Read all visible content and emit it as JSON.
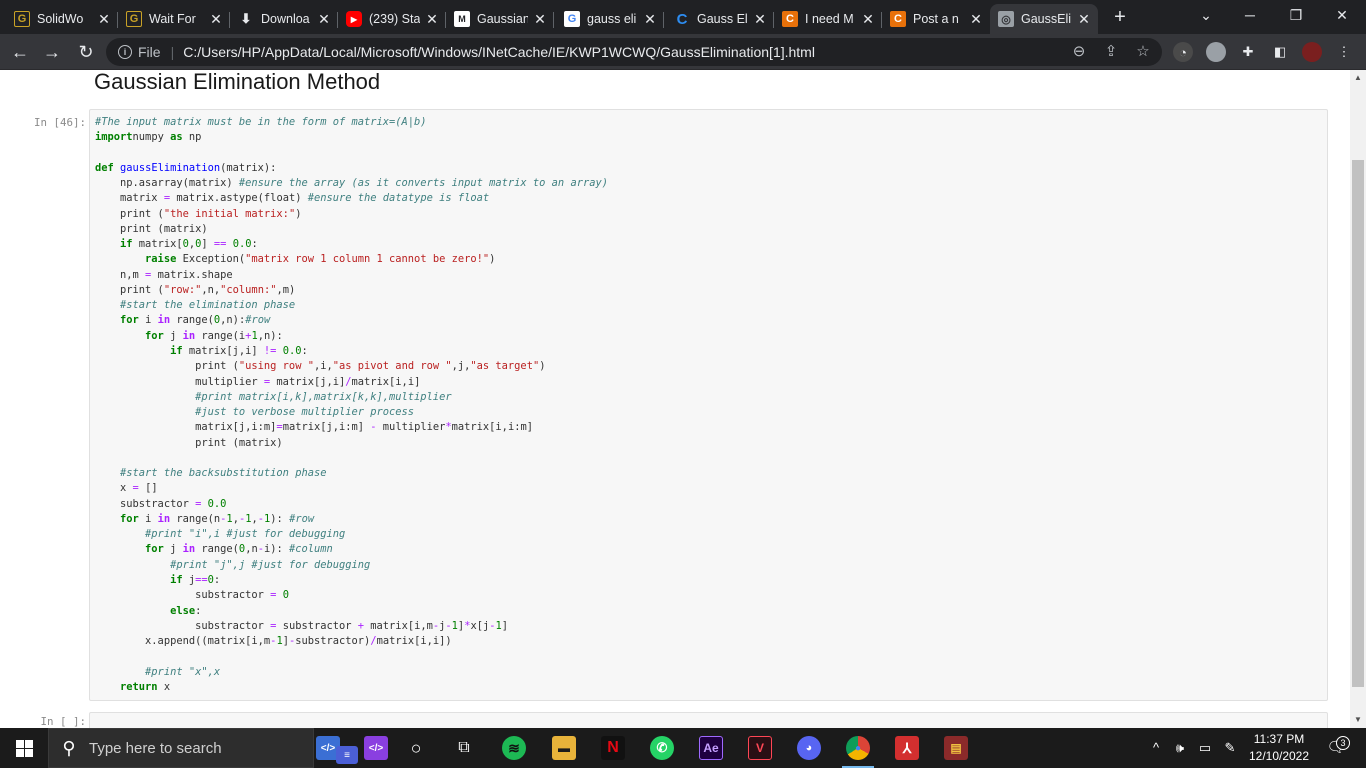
{
  "browser": {
    "tabs": [
      {
        "title": "SolidWo",
        "favicon": "g-icon"
      },
      {
        "title": "Wait For",
        "favicon": "g-icon"
      },
      {
        "title": "Downloa",
        "favicon": "download-icon"
      },
      {
        "title": "(239) Sta",
        "favicon": "youtube-icon"
      },
      {
        "title": "Gaussian",
        "favicon": "site-icon"
      },
      {
        "title": "gauss eli",
        "favicon": "google-icon"
      },
      {
        "title": "Gauss El",
        "favicon": "c-icon"
      },
      {
        "title": "I need M",
        "favicon": "chegg-icon"
      },
      {
        "title": "Post a n",
        "favicon": "chegg-icon"
      },
      {
        "title": "GaussEli",
        "favicon": "globe-icon",
        "active": true
      }
    ],
    "address": {
      "scheme_label": "File",
      "url": "C:/Users/HP/AppData/Local/Microsoft/Windows/INetCache/IE/KWP1WCWQ/GaussElimination[1].html"
    }
  },
  "notebook": {
    "heading": "Gaussian Elimination Method",
    "cell1_prompt": "In [46]:",
    "cell2_prompt": "In [ ]:",
    "code_lines": [
      [
        [
          "c-com",
          "#The input matrix must be in the form of matrix=(A|b)"
        ]
      ],
      [
        [
          "c-kw",
          "import"
        ],
        [
          "",
          "numpy "
        ],
        [
          "c-kw",
          "as"
        ],
        [
          "",
          " np"
        ]
      ],
      [
        [
          "",
          ""
        ]
      ],
      [
        [
          "c-kw",
          "def"
        ],
        [
          "",
          " "
        ],
        [
          "c-fn",
          "gaussElimination"
        ],
        [
          "",
          "(matrix):"
        ]
      ],
      [
        [
          "",
          "    np.asarray(matrix) "
        ],
        [
          "c-com",
          "#ensure the array (as it converts input matrix to an array)"
        ]
      ],
      [
        [
          "",
          "    matrix "
        ],
        [
          "c-op",
          "="
        ],
        [
          "",
          " matrix.astype(float) "
        ],
        [
          "c-com",
          "#ensure the datatype is float"
        ]
      ],
      [
        [
          "",
          "    print ("
        ],
        [
          "c-str",
          "\"the initial matrix:\""
        ],
        [
          "",
          ")"
        ]
      ],
      [
        [
          "",
          "    print (matrix)"
        ]
      ],
      [
        [
          "",
          "    "
        ],
        [
          "c-kw",
          "if"
        ],
        [
          "",
          " matrix["
        ],
        [
          "c-num",
          "0"
        ],
        [
          "",
          ","
        ],
        [
          "c-num",
          "0"
        ],
        [
          "",
          "] "
        ],
        [
          "c-op",
          "=="
        ],
        [
          "",
          " "
        ],
        [
          "c-num",
          "0.0"
        ],
        [
          "",
          ":"
        ]
      ],
      [
        [
          "",
          "        "
        ],
        [
          "c-kw",
          "raise"
        ],
        [
          "",
          " Exception("
        ],
        [
          "c-str",
          "\"matrix row 1 column 1 cannot be zero!\""
        ],
        [
          "",
          ")"
        ]
      ],
      [
        [
          "",
          "    n,m "
        ],
        [
          "c-op",
          "="
        ],
        [
          "",
          " matrix.shape"
        ]
      ],
      [
        [
          "",
          "    print ("
        ],
        [
          "c-str",
          "\"row:\""
        ],
        [
          "",
          ",n,"
        ],
        [
          "c-str",
          "\"column:\""
        ],
        [
          "",
          ",m)"
        ]
      ],
      [
        [
          "",
          "    "
        ],
        [
          "c-com",
          "#start the elimination phase"
        ]
      ],
      [
        [
          "",
          "    "
        ],
        [
          "c-kw",
          "for"
        ],
        [
          "",
          " i "
        ],
        [
          "c-kwop",
          "in"
        ],
        [
          "",
          " range("
        ],
        [
          "c-num",
          "0"
        ],
        [
          "",
          ",n):"
        ],
        [
          "c-com",
          "#row"
        ]
      ],
      [
        [
          "",
          "        "
        ],
        [
          "c-kw",
          "for"
        ],
        [
          "",
          " j "
        ],
        [
          "c-kwop",
          "in"
        ],
        [
          "",
          " range(i"
        ],
        [
          "c-op",
          "+"
        ],
        [
          "c-num",
          "1"
        ],
        [
          "",
          ",n):"
        ]
      ],
      [
        [
          "",
          "            "
        ],
        [
          "c-kw",
          "if"
        ],
        [
          "",
          " matrix[j,i] "
        ],
        [
          "c-op",
          "!="
        ],
        [
          "",
          " "
        ],
        [
          "c-num",
          "0.0"
        ],
        [
          "",
          ":"
        ]
      ],
      [
        [
          "",
          "                print ("
        ],
        [
          "c-str",
          "\"using row \""
        ],
        [
          "",
          ",i,"
        ],
        [
          "c-str",
          "\"as pivot and row \""
        ],
        [
          "",
          ",j,"
        ],
        [
          "c-str",
          "\"as target\""
        ],
        [
          "",
          ")"
        ]
      ],
      [
        [
          "",
          "                multiplier "
        ],
        [
          "c-op",
          "="
        ],
        [
          "",
          " matrix[j,i]"
        ],
        [
          "c-op",
          "/"
        ],
        [
          "",
          "matrix[i,i]"
        ]
      ],
      [
        [
          "",
          "                "
        ],
        [
          "c-com",
          "#print matrix[i,k],matrix[k,k],multiplier"
        ]
      ],
      [
        [
          "",
          "                "
        ],
        [
          "c-com",
          "#just to verbose multiplier process"
        ]
      ],
      [
        [
          "",
          "                matrix[j,i:m]"
        ],
        [
          "c-op",
          "="
        ],
        [
          "",
          "matrix[j,i:m] "
        ],
        [
          "c-op",
          "-"
        ],
        [
          "",
          " multiplier"
        ],
        [
          "c-op",
          "*"
        ],
        [
          "",
          "matrix[i,i:m]"
        ]
      ],
      [
        [
          "",
          "                print (matrix)"
        ]
      ],
      [
        [
          "",
          ""
        ]
      ],
      [
        [
          "",
          "    "
        ],
        [
          "c-com",
          "#start the backsubstitution phase"
        ]
      ],
      [
        [
          "",
          "    x "
        ],
        [
          "c-op",
          "="
        ],
        [
          "",
          " []"
        ]
      ],
      [
        [
          "",
          "    substractor "
        ],
        [
          "c-op",
          "="
        ],
        [
          "",
          " "
        ],
        [
          "c-num",
          "0.0"
        ]
      ],
      [
        [
          "",
          "    "
        ],
        [
          "c-kw",
          "for"
        ],
        [
          "",
          " i "
        ],
        [
          "c-kwop",
          "in"
        ],
        [
          "",
          " range(n"
        ],
        [
          "c-op",
          "-"
        ],
        [
          "c-num",
          "1"
        ],
        [
          "",
          ","
        ],
        [
          "c-op",
          "-"
        ],
        [
          "c-num",
          "1"
        ],
        [
          "",
          ","
        ],
        [
          "c-op",
          "-"
        ],
        [
          "c-num",
          "1"
        ],
        [
          "",
          "): "
        ],
        [
          "c-com",
          "#row"
        ]
      ],
      [
        [
          "",
          "        "
        ],
        [
          "c-com",
          "#print \"i\",i #just for debugging"
        ]
      ],
      [
        [
          "",
          "        "
        ],
        [
          "c-kw",
          "for"
        ],
        [
          "",
          " j "
        ],
        [
          "c-kwop",
          "in"
        ],
        [
          "",
          " range("
        ],
        [
          "c-num",
          "0"
        ],
        [
          "",
          ",n"
        ],
        [
          "c-op",
          "-"
        ],
        [
          "",
          "i): "
        ],
        [
          "c-com",
          "#column"
        ]
      ],
      [
        [
          "",
          "            "
        ],
        [
          "c-com",
          "#print \"j\",j #just for debugging"
        ]
      ],
      [
        [
          "",
          "            "
        ],
        [
          "c-kw",
          "if"
        ],
        [
          "",
          " j"
        ],
        [
          "c-op",
          "=="
        ],
        [
          "c-num",
          "0"
        ],
        [
          "",
          ":"
        ]
      ],
      [
        [
          "",
          "                substractor "
        ],
        [
          "c-op",
          "="
        ],
        [
          "",
          " "
        ],
        [
          "c-num",
          "0"
        ]
      ],
      [
        [
          "",
          "            "
        ],
        [
          "c-kw",
          "else"
        ],
        [
          "",
          ":"
        ]
      ],
      [
        [
          "",
          "                substractor "
        ],
        [
          "c-op",
          "="
        ],
        [
          "",
          " substractor "
        ],
        [
          "c-op",
          "+"
        ],
        [
          "",
          " matrix[i,m"
        ],
        [
          "c-op",
          "-"
        ],
        [
          "",
          "j"
        ],
        [
          "c-op",
          "-"
        ],
        [
          "c-num",
          "1"
        ],
        [
          "",
          "]"
        ],
        [
          "c-op",
          "*"
        ],
        [
          "",
          "x[j"
        ],
        [
          "c-op",
          "-"
        ],
        [
          "c-num",
          "1"
        ],
        [
          "",
          "]"
        ]
      ],
      [
        [
          "",
          "        x.append((matrix[i,m"
        ],
        [
          "c-op",
          "-"
        ],
        [
          "c-num",
          "1"
        ],
        [
          "",
          "]"
        ],
        [
          "c-op",
          "-"
        ],
        [
          "",
          "substractor)"
        ],
        [
          "c-op",
          "/"
        ],
        [
          "",
          "matrix[i,i])"
        ]
      ],
      [
        [
          "",
          ""
        ]
      ],
      [
        [
          "",
          "        "
        ],
        [
          "c-com",
          "#print \"x\",x"
        ]
      ],
      [
        [
          "",
          "    "
        ],
        [
          "c-kw",
          "return"
        ],
        [
          "",
          " x"
        ]
      ]
    ]
  },
  "taskbar": {
    "search_placeholder": "Type here to search",
    "time": "11:37 PM",
    "date": "12/10/2022",
    "notification_count": "3"
  }
}
